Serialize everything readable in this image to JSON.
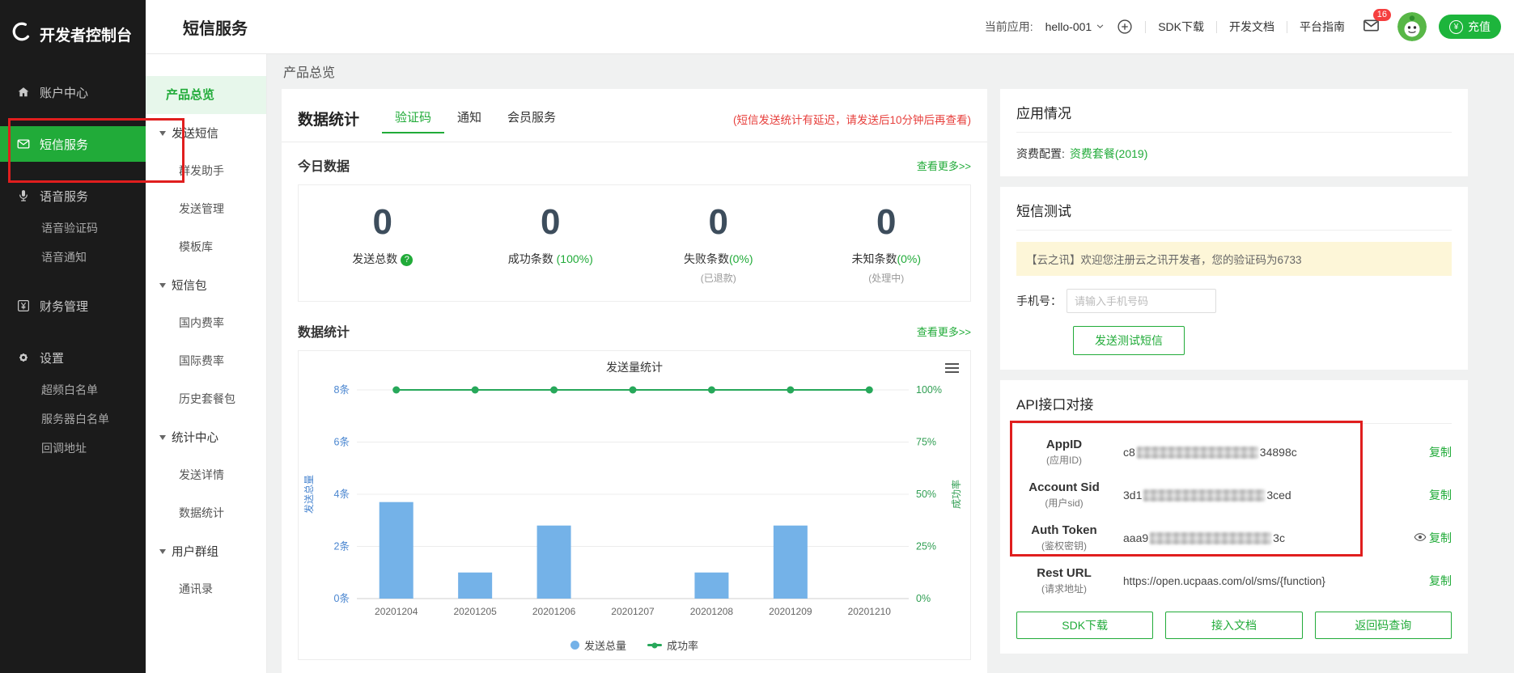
{
  "app": {
    "logo_text": "开发者控制台",
    "title": "短信服务"
  },
  "topbar": {
    "current_app_label": "当前应用:",
    "current_app_value": "hello-001",
    "links": [
      "SDK下载",
      "开发文档",
      "平台指南"
    ],
    "mail_badge": "16",
    "recharge_label": "充值"
  },
  "sidebar": {
    "items": [
      {
        "name": "account-center",
        "label": "账户中心",
        "icon": "home-icon",
        "type": "item",
        "active": false,
        "gap": false
      },
      {
        "name": "sms-service",
        "label": "短信服务",
        "icon": "mail-icon",
        "type": "item",
        "active": true,
        "gap": true
      },
      {
        "name": "voice-service",
        "label": "语音服务",
        "icon": "mic-icon",
        "type": "item",
        "active": false,
        "gap": true
      },
      {
        "name": "voice-captcha",
        "label": "语音验证码",
        "type": "subitem"
      },
      {
        "name": "voice-notify",
        "label": "语音通知",
        "type": "subitem"
      },
      {
        "name": "finance",
        "label": "财务管理",
        "icon": "yen-icon",
        "type": "item",
        "active": false,
        "gap": true
      },
      {
        "name": "settings",
        "label": "设置",
        "icon": "gear-icon",
        "type": "item",
        "active": false,
        "gap": true
      },
      {
        "name": "freq-whitelist",
        "label": "超频白名单",
        "type": "subitem"
      },
      {
        "name": "server-whitelist",
        "label": "服务器白名单",
        "type": "subitem"
      },
      {
        "name": "callback-url",
        "label": "回调地址",
        "type": "subitem"
      }
    ]
  },
  "submenu": {
    "items": [
      {
        "name": "product-overview",
        "label": "产品总览",
        "type": "item",
        "active": true
      },
      {
        "name": "send-sms",
        "label": "发送短信",
        "type": "group"
      },
      {
        "name": "bulk-assistant",
        "label": "群发助手",
        "type": "child"
      },
      {
        "name": "send-management",
        "label": "发送管理",
        "type": "child"
      },
      {
        "name": "template-library",
        "label": "模板库",
        "type": "child"
      },
      {
        "name": "sms-package",
        "label": "短信包",
        "type": "group"
      },
      {
        "name": "domestic-rates",
        "label": "国内费率",
        "type": "child"
      },
      {
        "name": "international-rates",
        "label": "国际费率",
        "type": "child"
      },
      {
        "name": "history-packages",
        "label": "历史套餐包",
        "type": "child"
      },
      {
        "name": "stats-center",
        "label": "统计中心",
        "type": "group"
      },
      {
        "name": "send-details",
        "label": "发送详情",
        "type": "child"
      },
      {
        "name": "data-stats",
        "label": "数据统计",
        "type": "child"
      },
      {
        "name": "user-groups",
        "label": "用户群组",
        "type": "group"
      },
      {
        "name": "contacts",
        "label": "通讯录",
        "type": "child"
      }
    ]
  },
  "content": {
    "breadcrumb": "产品总览",
    "panel": {
      "title": "数据统计",
      "tabs": [
        {
          "label": "验证码",
          "active": true
        },
        {
          "label": "通知",
          "active": false
        },
        {
          "label": "会员服务",
          "active": false
        }
      ],
      "notice": "(短信发送统计有延迟，请发送后10分钟后再查看)",
      "today_title": "今日数据",
      "more_label": "查看更多>>",
      "stats": [
        {
          "value": "0",
          "label": "发送总数",
          "help": true
        },
        {
          "value": "0",
          "label": "成功条数",
          "percent": " (100%)"
        },
        {
          "value": "0",
          "label": "失败条数",
          "percent": "(0%)",
          "sub": "(已退款)"
        },
        {
          "value": "0",
          "label": "未知条数",
          "percent": "(0%)",
          "sub": "(处理中)"
        }
      ],
      "chart_section_title": "数据统计"
    }
  },
  "chart_data": {
    "type": "bar+line",
    "title": "发送量统计",
    "categories": [
      "20201204",
      "20201205",
      "20201206",
      "20201207",
      "20201208",
      "20201209",
      "20201210"
    ],
    "series": [
      {
        "name": "发送总量",
        "type": "bar",
        "axis": "left",
        "color": "#74b2e8",
        "values": [
          3.7,
          1,
          2.8,
          0,
          1,
          2.8,
          0
        ]
      },
      {
        "name": "成功率",
        "type": "line",
        "axis": "right",
        "color": "#27a85a",
        "values": [
          100,
          100,
          100,
          100,
          100,
          100,
          100
        ]
      }
    ],
    "yaxis_left": {
      "label": "发送总量",
      "min": 0,
      "max": 8,
      "ticks": [
        "0条",
        "2条",
        "4条",
        "6条",
        "8条"
      ]
    },
    "yaxis_right": {
      "label": "成功率",
      "min": 0,
      "max": 100,
      "ticks": [
        "0%",
        "25%",
        "50%",
        "75%",
        "100%"
      ]
    },
    "legend_position": "bottom",
    "grid": true
  },
  "right": {
    "app_card": {
      "title": "应用情况",
      "fee_label": "资费配置:",
      "fee_link": "资费套餐(2019)"
    },
    "test_card": {
      "title": "短信测试",
      "sample_sms": "【云之讯】欢迎您注册云之讯开发者，您的验证码为6733",
      "phone_label": "手机号：",
      "phone_placeholder": "请输入手机号码",
      "send_button": "发送测试短信"
    },
    "api_card": {
      "title": "API接口对接",
      "copy_label": "复制",
      "rows": [
        {
          "name": "AppID",
          "sub": "(应用ID)",
          "value_prefix": "c8",
          "value_suffix": "34898c",
          "masked": true
        },
        {
          "name": "Account Sid",
          "sub": "(用户sid)",
          "value_prefix": "3d1",
          "value_suffix": "3ced",
          "masked": true
        },
        {
          "name": "Auth Token",
          "sub": "(鉴权密钥)",
          "value_prefix": "aaa9",
          "value_suffix": "3c",
          "masked": true,
          "eye": true
        },
        {
          "name": "Rest URL",
          "sub": "(请求地址)",
          "value": "https://open.ucpaas.com/ol/sms/{function}",
          "masked": false
        }
      ],
      "buttons": [
        "SDK下载",
        "接入文档",
        "返回码查询"
      ]
    }
  },
  "colors": {
    "primary_green": "#21ab39",
    "recharge_green": "#1db53c",
    "danger_red": "#e7403d",
    "annotation_red": "#e01e1e",
    "bar_blue": "#74b2e8",
    "axis_blue": "#4a86d0",
    "axis_green": "#2f9e52",
    "notice_bg": "#fdf6d8",
    "badge_red": "#f53f3f",
    "number_dark": "#3d4d5c"
  }
}
